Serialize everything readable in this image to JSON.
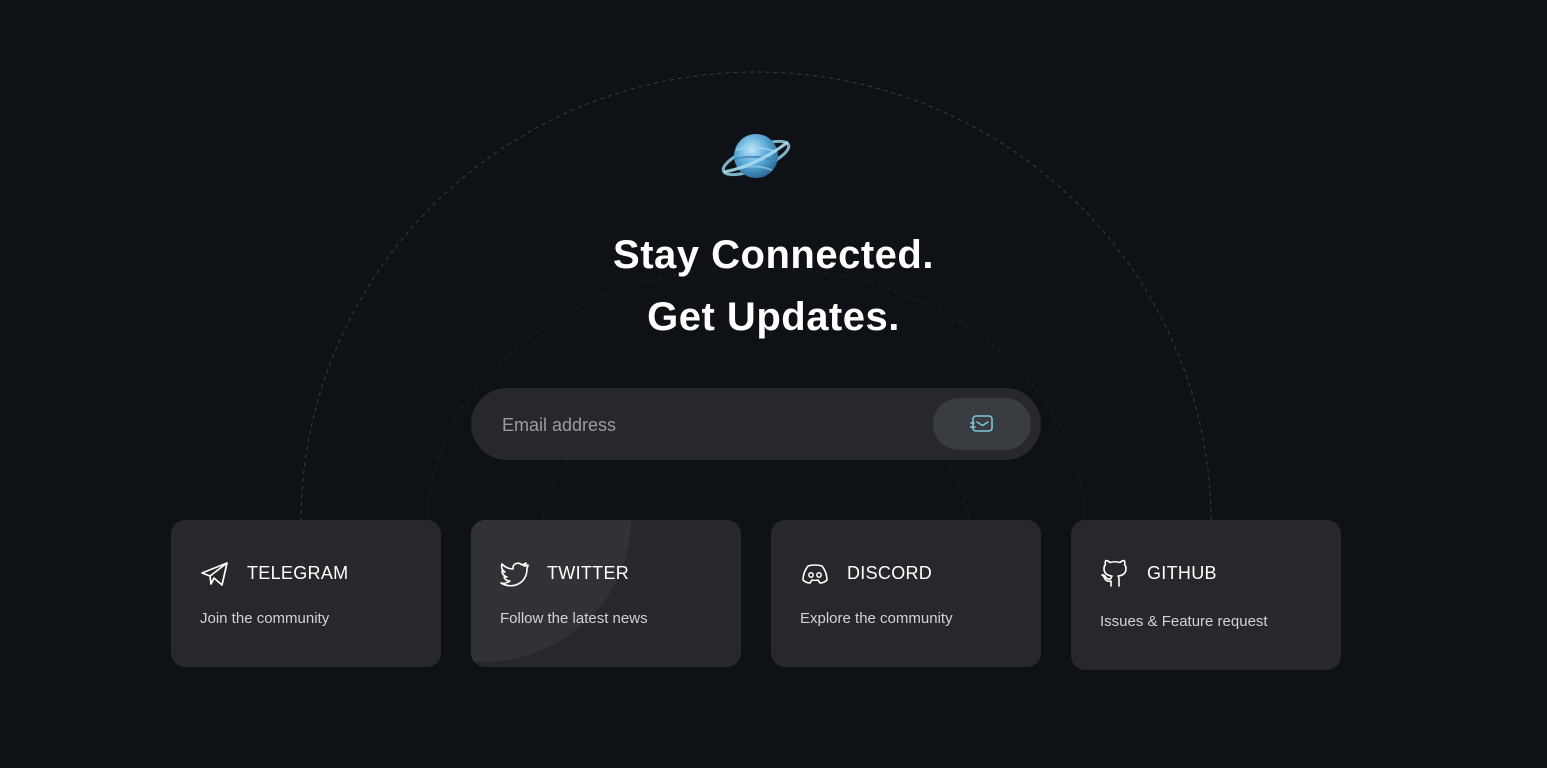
{
  "hero": {
    "headline_line1": "Stay Connected.",
    "headline_line2": "Get Updates."
  },
  "subscribe": {
    "email_placeholder": "Email address",
    "email_value": ""
  },
  "cards": [
    {
      "icon": "telegram-icon",
      "title": "TELEGRAM",
      "description": "Join the community"
    },
    {
      "icon": "twitter-icon",
      "title": "TWITTER",
      "description": "Follow the latest news"
    },
    {
      "icon": "discord-icon",
      "title": "DISCORD",
      "description": "Explore the community"
    },
    {
      "icon": "github-icon",
      "title": "GITHUB",
      "description": "Issues & Feature request"
    }
  ],
  "colors": {
    "background": "#0e1115",
    "card": "#27282c",
    "input": "#26282c",
    "button": "#393c41",
    "send_icon": "#7cc7d9",
    "arc": "#1f4a3a"
  }
}
